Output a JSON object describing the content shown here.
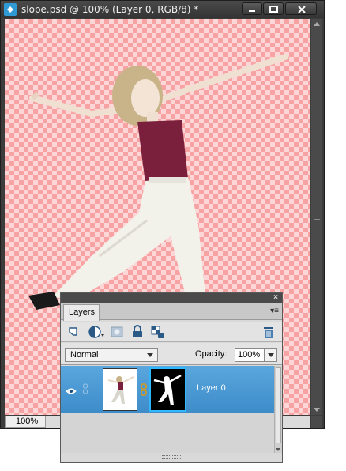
{
  "document": {
    "title": "slope.psd @ 100% (Layer 0, RGB/8) *",
    "zoom": "100%"
  },
  "window_controls": {
    "minimize_icon": "minimize-icon",
    "maximize_icon": "maximize-icon",
    "close_icon": "close-icon"
  },
  "layers_panel": {
    "tab_label": "Layers",
    "close_glyph": "×",
    "menu_glyph": "▾≡",
    "blend_mode": "Normal",
    "opacity_label": "Opacity:",
    "opacity_value": "100%",
    "toolbar_icons": [
      "new-layer-icon",
      "adjustment-layer-icon",
      "layer-mask-icon",
      "lock-all-icon",
      "lock-transparency-icon",
      "trash-icon"
    ],
    "layers": [
      {
        "name": "Layer 0",
        "visible": true,
        "selected": true,
        "has_mask": true
      }
    ]
  },
  "colors": {
    "selection": "#4a9ad5",
    "checker_pink": "#f7a3a3",
    "mask_border": "#2fb8ff"
  }
}
